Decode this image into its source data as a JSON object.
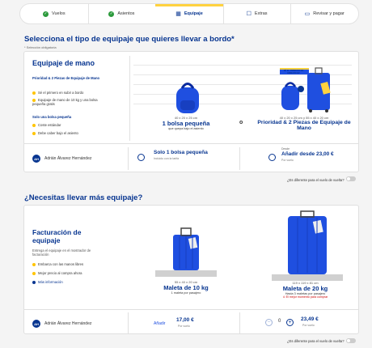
{
  "steps": [
    {
      "label": "Vuelos",
      "icon": "check-icon",
      "done": true
    },
    {
      "label": "Asientos",
      "icon": "check-icon",
      "done": true
    },
    {
      "label": "Equipaje",
      "icon": "suitcase-icon",
      "active": true
    },
    {
      "label": "Extras",
      "icon": "extras-icon"
    },
    {
      "label": "Revisar y pagar",
      "icon": "card-icon"
    }
  ],
  "section1": {
    "title": "Selecciona el tipo de equipaje que quieres llevar a bordo*",
    "subtitle": "* Selección obligatoria"
  },
  "hand": {
    "title": "Equipaje de mano",
    "priority_title": "Prioridad & 2 Piezas de Equipaje de Mano",
    "priority_items": [
      "Sé el primero en subir a bordo",
      "Equipaje de mano de 10 kg y una bolsa pequeña gratis"
    ],
    "small_title": "Solo una bolsa pequeña",
    "small_items": [
      "Coste estándar",
      "Debe caber bajo el asiento"
    ],
    "bag_dims": "40 x 20 x 25 cm",
    "bag_name": "1 bolsa pequeña",
    "bag_sub": "que quepa bajo el asiento",
    "or": "o",
    "prio_dims": "40 x 20 x 25 cm y 55 x 40 x 20 cm",
    "prio_name": "Prioridad & 2 Piezas de Equipaje de Mano",
    "tag": "SÉ EL PRIMERO EN EMBARCAR"
  },
  "passenger": {
    "initials": "AH",
    "name": "Adrián Álvarez Hernández"
  },
  "option_small": {
    "label": "Solo 1 bolsa pequeña",
    "sub": "Incluido con la tarifa"
  },
  "option_prio": {
    "from": "Desde",
    "label": "Añadir desde 23,00 €",
    "sub": "Por vuelo"
  },
  "return_note": "¿Es diferente para el vuelo de vuelta?",
  "section2": {
    "title": "¿Necesitas llevar más equipaje?"
  },
  "checked": {
    "title": "Facturación de equipaje",
    "desc": "Entrega el equipaje en el mostrador de facturación",
    "items": [
      "Embarca con las manos libres",
      "Mejor precio al compra ahora"
    ],
    "more": "Más información",
    "m10_dims": "55 x 40 x 20 cm",
    "m10_name": "Maleta de 10 kg",
    "m10_sub": "1 maleta por pasajero",
    "m20_dims": "119 x 119 x 81 cm",
    "m20_name": "Maleta de 20 kg",
    "m20_sub": "Hasta 3 maletas por pasajero",
    "m20_warn": "El mejor momento para comprar"
  },
  "add10": {
    "label": "Añadir",
    "price": "17,00 €",
    "sub": "Por vuelo"
  },
  "add20": {
    "qty": "0",
    "price": "23,49 €",
    "sub": "Por vuelo"
  }
}
